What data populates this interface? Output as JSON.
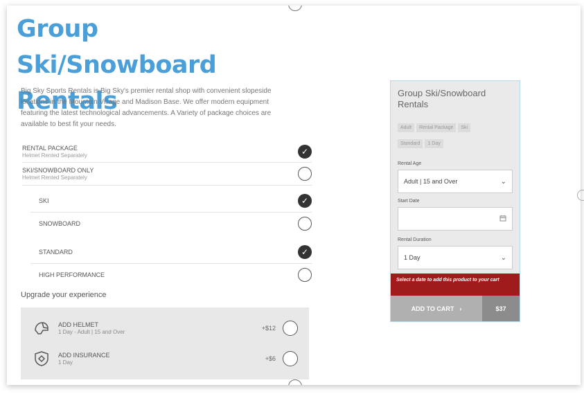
{
  "product": {
    "title": "Group Ski/Snowboard Rentals",
    "description": "Big Sky Sports Rentals is Big Sky's premier rental shop with convenient slopeside locations in the Mountain Village and Madison Base. We offer modern equipment featuring the latest technological advancements. A Variety of package choices are available to best fit your needs."
  },
  "options": {
    "rental_package": {
      "label": "RENTAL PACKAGE",
      "sub": "Helmet Rented Separately",
      "selected": true
    },
    "ski_snowboard_only": {
      "label": "SKI/SNOWBOARD ONLY",
      "sub": "Helmet Rented Separately",
      "selected": false
    },
    "ski": {
      "label": "SKI",
      "selected": true
    },
    "snowboard": {
      "label": "SNOWBOARD",
      "selected": false
    },
    "standard": {
      "label": "STANDARD",
      "selected": true
    },
    "high_performance": {
      "label": "HIGH PERFORMANCE",
      "selected": false
    }
  },
  "upgrade": {
    "heading": "Upgrade your experience",
    "helmet": {
      "label": "ADD HELMET",
      "sub": "1 Day - Adult | 15 and Over",
      "price": "+$12",
      "icon": "helmet-icon"
    },
    "insurance": {
      "label": "ADD INSURANCE",
      "sub": "1 Day",
      "price": "+$6",
      "icon": "shield-icon"
    }
  },
  "summary": {
    "title": "Group Ski/Snowboard Rentals",
    "tags": [
      "Adult",
      "Rental Package",
      "Ski",
      "Standard",
      "1 Day"
    ],
    "rental_age_label": "Rental Age",
    "rental_age_value": "Adult | 15 and Over",
    "start_date_label": "Start Date",
    "start_date_value": "",
    "rental_duration_label": "Rental Duration",
    "rental_duration_value": "1 Day",
    "warning": "Select a date to add this product to your cart",
    "add_to_cart": "ADD TO CART",
    "price": "$37"
  },
  "colors": {
    "title_blue": "#4a9fd8",
    "warning_red": "#a01c1c",
    "cart_gray": "#b0b0b0"
  }
}
